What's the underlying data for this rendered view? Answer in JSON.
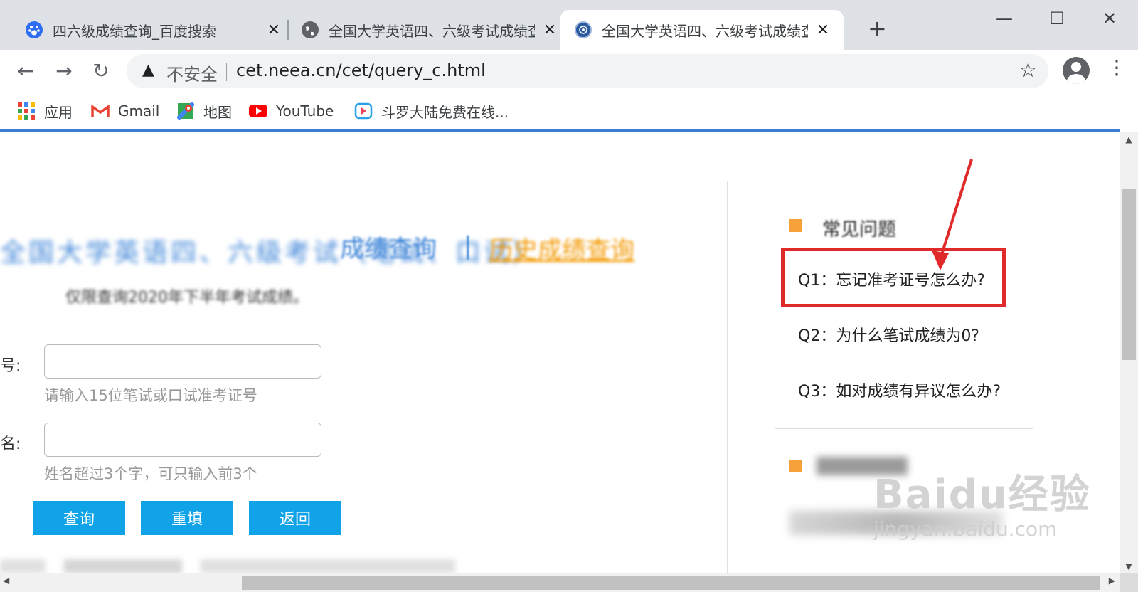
{
  "browser": {
    "tabs": [
      {
        "title": "四六级成绩查询_百度搜索",
        "favicon": "baidu-paw-icon"
      },
      {
        "title": "全国大学英语四、六级考试成绩查询",
        "favicon": "globe-icon"
      },
      {
        "title": "全国大学英语四、六级考试成绩查询",
        "favicon": "neea-logo-icon",
        "active": true
      }
    ],
    "new_tab_symbol": "+",
    "window_controls": {
      "minimize": "—",
      "maximize": "☐",
      "close": "✕"
    },
    "security_label": "不安全",
    "url": "cet.neea.cn/cet/query_c.html",
    "bookmarks": [
      {
        "label": "应用",
        "icon": "apps-grid-icon"
      },
      {
        "label": "Gmail",
        "icon": "gmail-icon"
      },
      {
        "label": "地图",
        "icon": "maps-icon"
      },
      {
        "label": "YouTube",
        "icon": "youtube-icon"
      },
      {
        "label": "斗罗大陆免费在线...",
        "icon": "video-play-icon"
      }
    ],
    "accent_color": "#3b7bd1"
  },
  "page": {
    "title_blurred": "全国大学英语四、六级考试（笔试、口试）",
    "title_main": "成绩查询",
    "title_separator": "|",
    "history_link": "历史成绩查询",
    "notice": "仅限查询2020年下半年考试成绩。",
    "form": {
      "ticket_label": "号:",
      "ticket_hint": "请输入15位笔试或口试准考证号",
      "name_label": "名:",
      "name_hint": "姓名超过3个字，可只输入前3个",
      "buttons": {
        "query": "查询",
        "reset": "重填",
        "back": "返回"
      },
      "button_color": "#10a3e8"
    },
    "sidebar": {
      "faq_heading": "常见问题",
      "faqs": [
        "Q1：忘记准考证号怎么办?",
        "Q2：为什么笔试成绩为0?",
        "Q3：如对成绩有异议怎么办?"
      ],
      "highlight_color": "#e02a2a",
      "marker_color": "#f7a13b"
    },
    "watermark": {
      "logo": "Baidu经验",
      "sub": "jingyan.baidu.com"
    }
  }
}
